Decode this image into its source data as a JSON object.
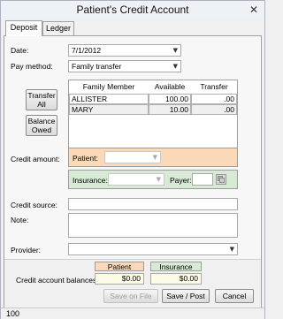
{
  "window": {
    "title": "Patient's Credit Account",
    "close_glyph": "✕"
  },
  "tabs": [
    {
      "label": "Deposit"
    },
    {
      "label": "Ledger"
    }
  ],
  "deposit": {
    "date_label": "Date:",
    "date_value": "7/1/2012",
    "pay_method_label": "Pay method:",
    "pay_method_value": "Family transfer",
    "transfer_all_label": "Transfer All",
    "balance_owed_label": "Balance Owed",
    "family_table": {
      "columns": [
        "Family Member",
        "Available",
        "Transfer"
      ],
      "rows": [
        {
          "member": "ALLISTER",
          "available": "100.00",
          "transfer": ".00"
        },
        {
          "member": "MARY",
          "available": "10.00",
          "transfer": ".00"
        }
      ]
    },
    "credit_amount_label": "Credit amount:",
    "patient_label": "Patient:",
    "insurance_label": "Insurance:",
    "payer_label": "Payer:",
    "credit_source_label": "Credit source:",
    "note_label": "Note:",
    "provider_label": "Provider:",
    "balances": {
      "label": "Credit account balances:",
      "patient_header": "Patient",
      "insurance_header": "Insurance",
      "patient_value": "$0.00",
      "insurance_value": "$0.00"
    }
  },
  "buttons": {
    "save_on_file": "Save on File",
    "save_post": "Save / Post",
    "cancel": "Cancel"
  },
  "status": {
    "text": "100"
  },
  "colors": {
    "patient_accent": "#fbd9b8",
    "insurance_accent": "#d6ead4"
  },
  "icons": {
    "dropdown": "chevron-down-icon",
    "payer_lookup": "payer-lookup-icon"
  }
}
